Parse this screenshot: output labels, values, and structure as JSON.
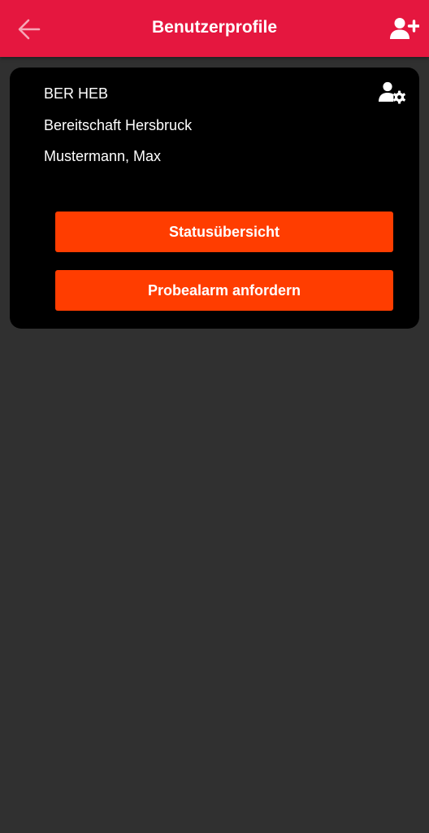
{
  "colors": {
    "app_bar": "#e5173f",
    "background": "#303030",
    "card": "#000000",
    "button": "#ff3d00",
    "text": "#ffffff"
  },
  "app_bar": {
    "title": "Benutzerprofile",
    "back_icon": "arrow-left-icon",
    "add_icon": "user-plus-icon"
  },
  "profile_card": {
    "code": "BER HEB",
    "unit": "Bereitschaft Hersbruck",
    "name": "Mustermann, Max",
    "settings_icon": "user-gear-icon",
    "buttons": {
      "status": "Statusübersicht",
      "test_alarm": "Probealarm anfordern"
    }
  }
}
